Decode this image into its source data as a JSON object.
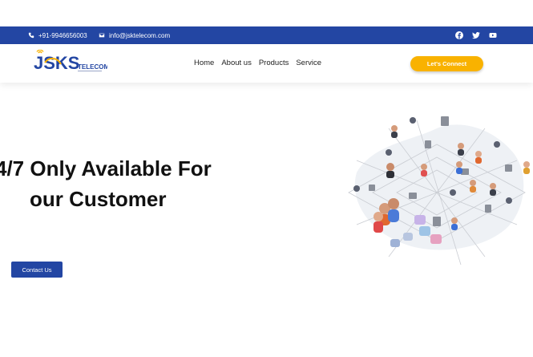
{
  "topbar": {
    "phone": "+91-9946656003",
    "email": "info@jsktelecom.com",
    "socials": [
      "facebook-icon",
      "twitter-icon",
      "youtube-icon"
    ],
    "color": "#2346a3"
  },
  "nav": {
    "logo_text": "JSKS",
    "logo_sub": "TELECOM",
    "items": [
      "Home",
      "About us",
      "Products",
      "Service"
    ],
    "cta_label": "Let's Connect",
    "cta_color": "#f9b200"
  },
  "hero": {
    "line1": "4/7 Only Available For",
    "line2": "our Customer",
    "button_label": "Contact Us",
    "illustration": "network-people-illustration"
  }
}
